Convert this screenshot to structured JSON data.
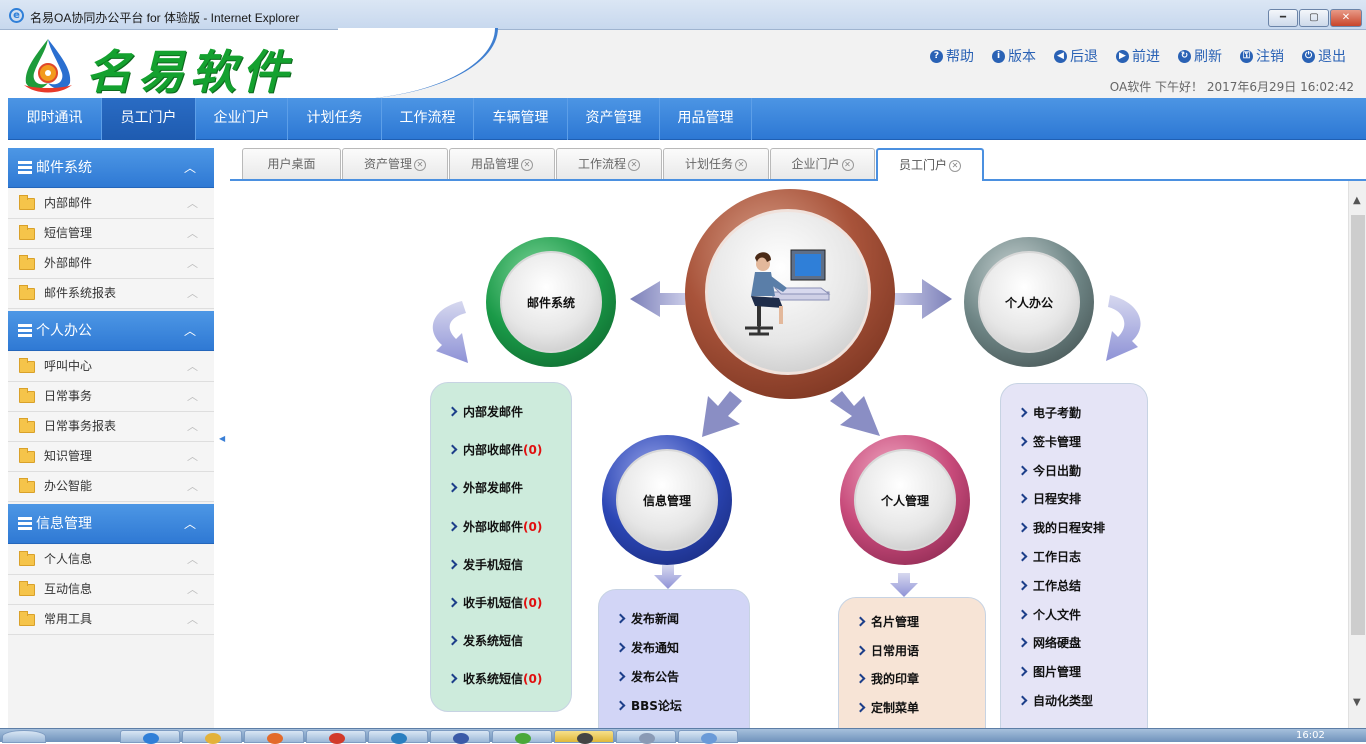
{
  "window": {
    "title": "名易OA协同办公平台 for 体验版 - Internet Explorer",
    "min_label": "━",
    "max_label": "▢",
    "close_label": "✕"
  },
  "header": {
    "brand": "名易软件",
    "tools": [
      {
        "icon": "question-icon",
        "glyph": "?",
        "label": "帮助"
      },
      {
        "icon": "info-icon",
        "glyph": "i",
        "label": "版本"
      },
      {
        "icon": "back-icon",
        "glyph": "◀",
        "label": "后退"
      },
      {
        "icon": "forward-icon",
        "glyph": "▶",
        "label": "前进"
      },
      {
        "icon": "refresh-icon",
        "glyph": "↻",
        "label": "刷新"
      },
      {
        "icon": "lock-icon",
        "glyph": "⚿",
        "label": "注销"
      },
      {
        "icon": "power-icon",
        "glyph": "⏻",
        "label": "退出"
      }
    ],
    "greeting": "OA软件 下午好！ 2017年6月29日 16:02:42"
  },
  "nav": {
    "items": [
      "即时通讯",
      "员工门户",
      "企业门户",
      "计划任务",
      "工作流程",
      "车辆管理",
      "资产管理",
      "用品管理"
    ],
    "active": "员工门户"
  },
  "sidebar": {
    "groups": [
      {
        "title": "邮件系统",
        "items": [
          "内部邮件",
          "短信管理",
          "外部邮件",
          "邮件系统报表"
        ]
      },
      {
        "title": "个人办公",
        "items": [
          "呼叫中心",
          "日常事务",
          "日常事务报表",
          "知识管理",
          "办公智能"
        ]
      },
      {
        "title": "信息管理",
        "items": [
          "个人信息",
          "互动信息",
          "常用工具"
        ]
      }
    ],
    "collapse_glyph": "︿",
    "item_up_glyph": "︿",
    "splitter_glyph": "◀"
  },
  "tabs": [
    {
      "label": "用户桌面",
      "closable": false
    },
    {
      "label": "资产管理",
      "closable": true
    },
    {
      "label": "用品管理",
      "closable": true
    },
    {
      "label": "工作流程",
      "closable": true
    },
    {
      "label": "计划任务",
      "closable": true
    },
    {
      "label": "企业门户",
      "closable": true
    },
    {
      "label": "员工门户",
      "closable": true,
      "active": true
    }
  ],
  "tab_close_glyph": "✕",
  "portal": {
    "hub_icon": "person-at-computer-icon",
    "mail": {
      "title": "邮件系统",
      "links": [
        {
          "label": "内部发邮件"
        },
        {
          "label": "内部收邮件",
          "count": "(0)"
        },
        {
          "label": "外部发邮件"
        },
        {
          "label": "外部收邮件",
          "count": "(0)"
        },
        {
          "label": "发手机短信"
        },
        {
          "label": "收手机短信",
          "count": "(0)"
        },
        {
          "label": "发系统短信"
        },
        {
          "label": "收系统短信",
          "count": "(0)"
        }
      ]
    },
    "info": {
      "title": "信息管理",
      "links": [
        "发布新闻",
        "发布通知",
        "发布公告",
        "BBS论坛"
      ]
    },
    "personal_mgmt": {
      "title": "个人管理",
      "links": [
        "名片管理",
        "日常用语",
        "我的印章",
        "定制菜单"
      ]
    },
    "personal_office": {
      "title": "个人办公",
      "links": [
        "电子考勤",
        "签卡管理",
        "今日出勤",
        "日程安排",
        "我的日程安排",
        "工作日志",
        "工作总结",
        "个人文件",
        "网络硬盘",
        "图片管理",
        "自动化类型"
      ]
    }
  },
  "scroll": {
    "up_glyph": "▲",
    "down_glyph": "▼"
  },
  "taskbar": {
    "clock": "16:02"
  },
  "colors": {
    "nav_blue": "#2d78d4",
    "brand_green": "#14a12f",
    "mail_green": "#1a9a48",
    "info_blue": "#2b46b5",
    "hub_brown": "#9e4a30",
    "personal_mgmt_pink": "#c74a7a",
    "personal_office_gray": "#6f8686",
    "count_red": "#e01010"
  }
}
